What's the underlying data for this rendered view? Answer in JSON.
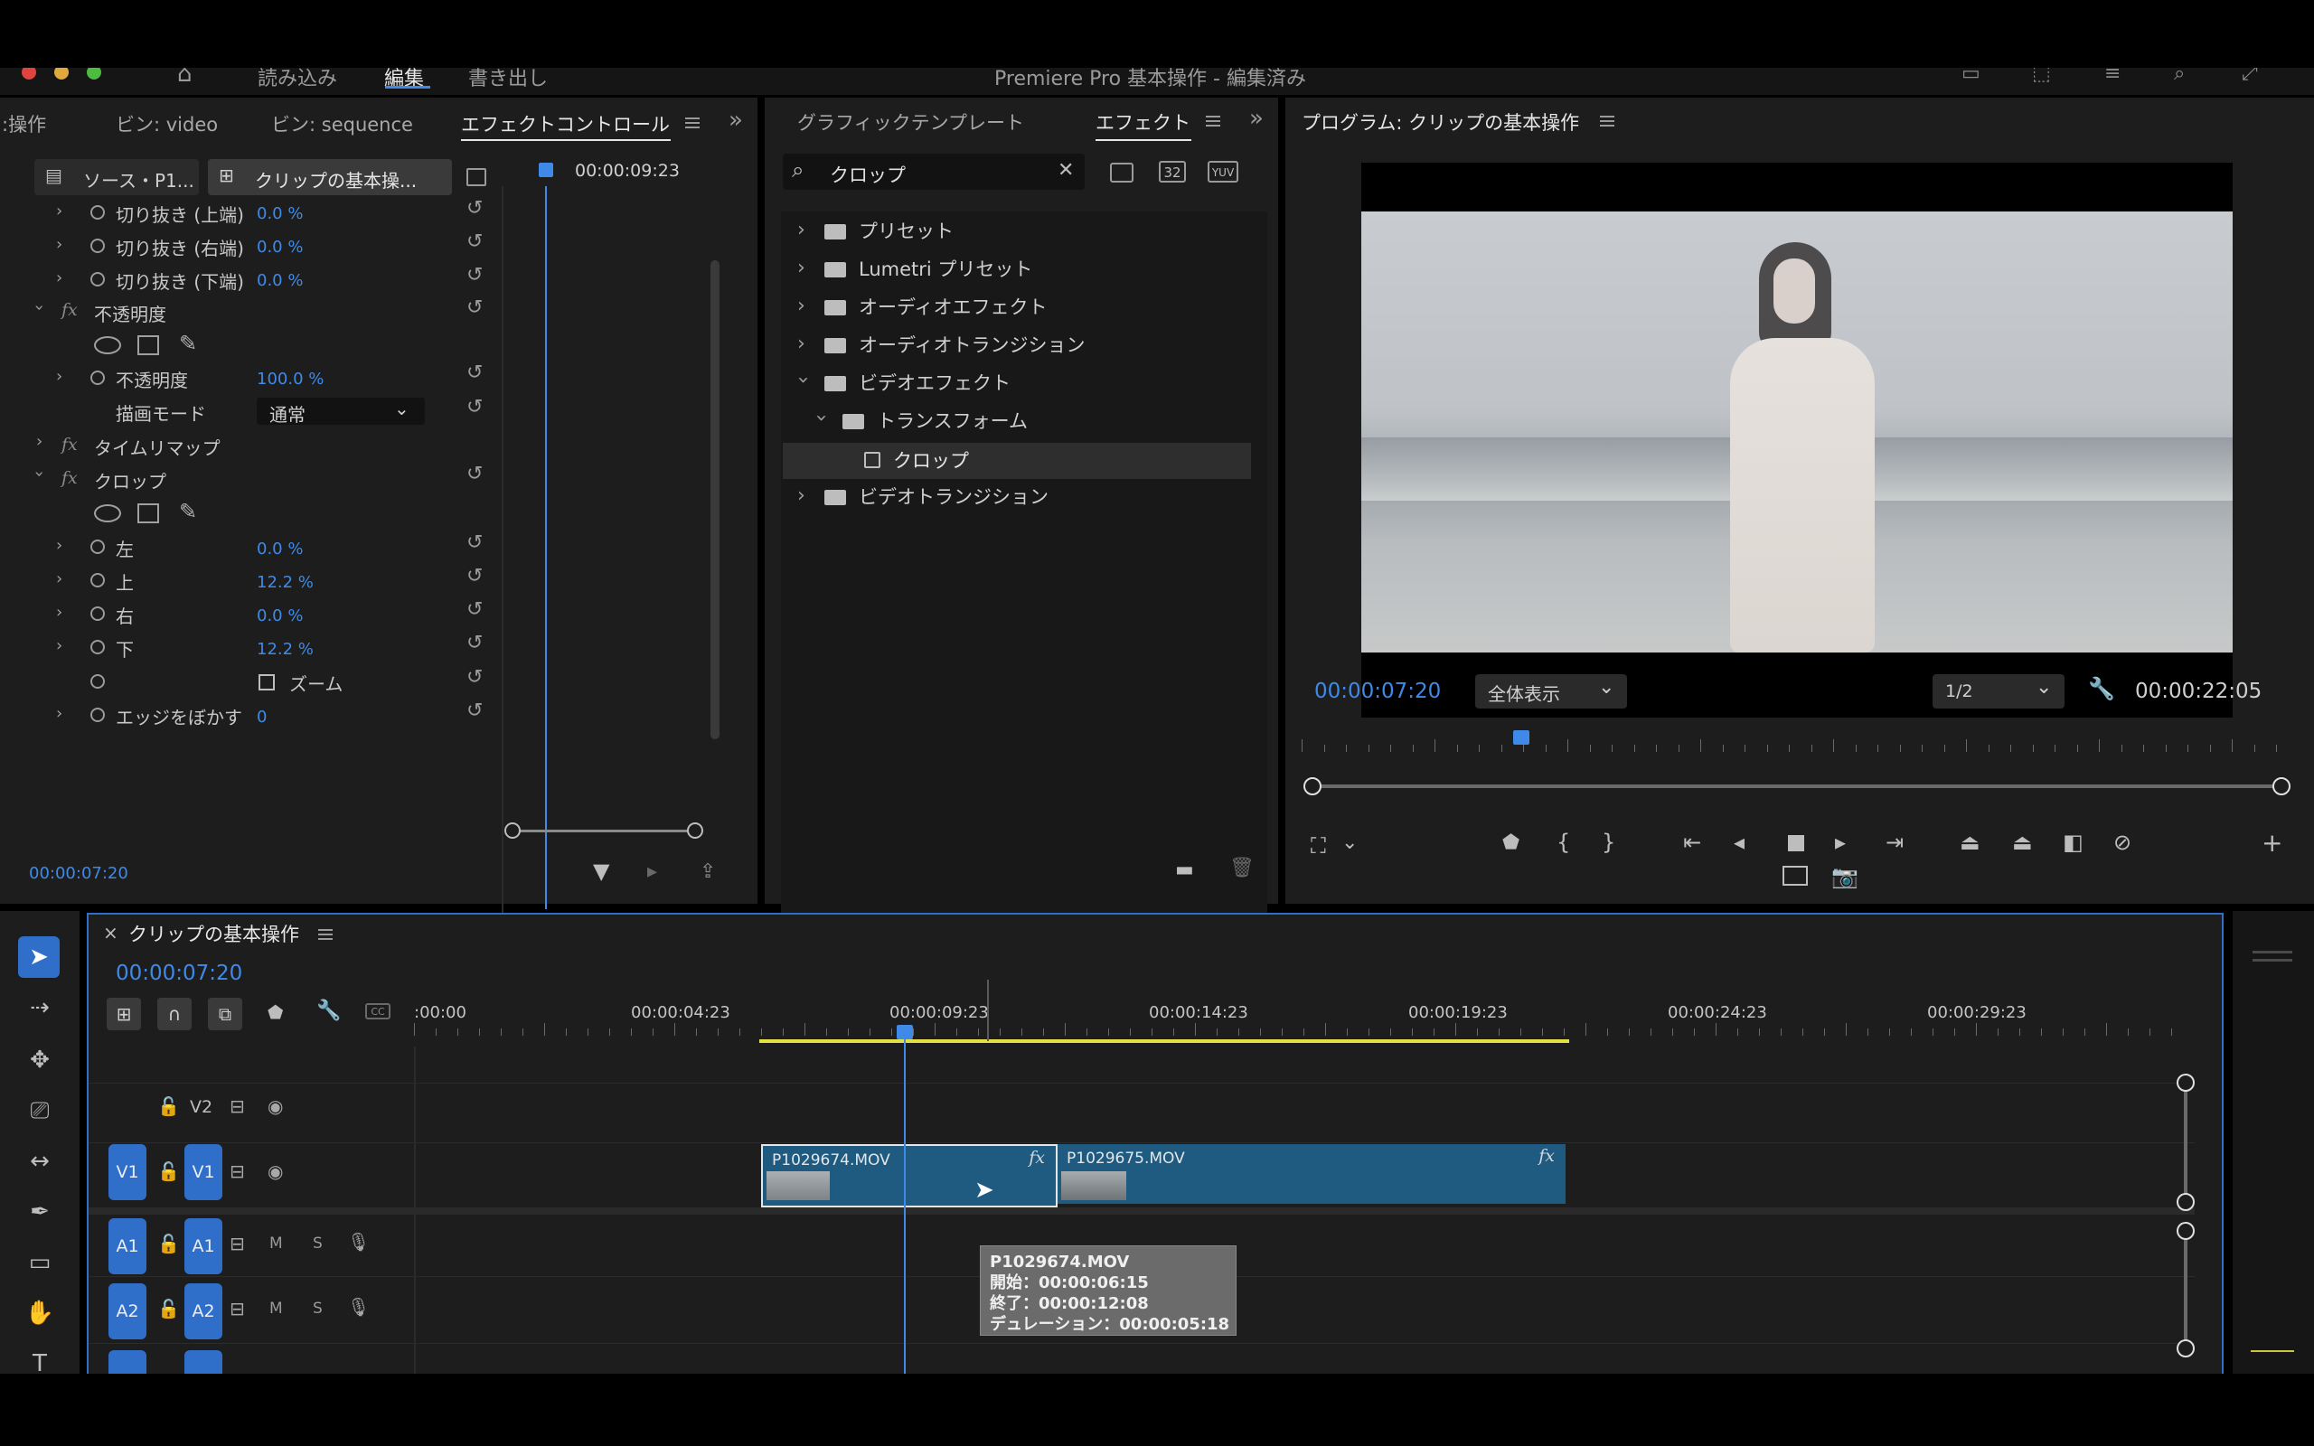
{
  "app": {
    "title": "Premiere Pro 基本操作 - 編集済み",
    "nav": [
      "読み込み",
      "編集",
      "書き出し"
    ]
  },
  "effect_controls": {
    "tabs": [
      ":操作",
      "ビン: video",
      "ビン: sequence",
      "エフェクトコントロール"
    ],
    "source_tab": "ソース・P1...",
    "clip_tab": "クリップの基本操...",
    "timecode_top": "00:00:09:23",
    "rows": [
      {
        "label": "切り抜き (上端)",
        "value": "0.0 %"
      },
      {
        "label": "切り抜き (右端)",
        "value": "0.0 %"
      },
      {
        "label": "切り抜き (下端)",
        "value": "0.0 %"
      }
    ],
    "opacity": {
      "section": "不透明度",
      "label": "不透明度",
      "value": "100.0 %",
      "blend_label": "描画モード",
      "blend_value": "通常"
    },
    "timeremap": "タイムリマップ",
    "crop": {
      "section": "クロップ",
      "left": {
        "label": "左",
        "value": "0.0 %"
      },
      "top": {
        "label": "上",
        "value": "12.2 %"
      },
      "right": {
        "label": "右",
        "value": "0.0 %"
      },
      "bottom": {
        "label": "下",
        "value": "12.2 %"
      },
      "zoom": "ズーム",
      "feather": {
        "label": "エッジをぼかす",
        "value": "0"
      }
    },
    "timecode_bottom": "00:00:07:20"
  },
  "effects_panel": {
    "tabs": [
      "グラフィックテンプレート",
      "エフェクト"
    ],
    "search_value": "クロップ",
    "tree": [
      "プリセット",
      "Lumetri プリセット",
      "オーディオエフェクト",
      "オーディオトランジション",
      "ビデオエフェクト",
      "トランスフォーム",
      "クロップ",
      "ビデオトランジション"
    ],
    "badges": [
      "32",
      "YUV"
    ]
  },
  "program": {
    "title": "プログラム: クリップの基本操作",
    "timecode": "00:00:07:20",
    "fit": "全体表示",
    "quality": "1/2",
    "duration": "00:00:22:05"
  },
  "timeline": {
    "title": "クリップの基本操作",
    "timecode": "00:00:07:20",
    "ruler": [
      ":00:00",
      "00:00:04:23",
      "00:00:09:23",
      "00:00:14:23",
      "00:00:19:23",
      "00:00:24:23",
      "00:00:29:23"
    ],
    "tracks": {
      "v2": "V2",
      "v1": "V1",
      "a1": "A1",
      "a2": "A2",
      "m": "M",
      "s": "S"
    },
    "clips": [
      {
        "name": "P1029674.MOV"
      },
      {
        "name": "P1029675.MOV"
      }
    ],
    "tooltip": [
      "P1029674.MOV",
      "開始：00:00:06:15",
      "終了：00:00:12:08",
      "デュレーション：00:00:05:18"
    ]
  },
  "colors": {
    "accent": "#3f8ae8",
    "clip": "#1f5a80",
    "panel": "#1d1d1d"
  }
}
